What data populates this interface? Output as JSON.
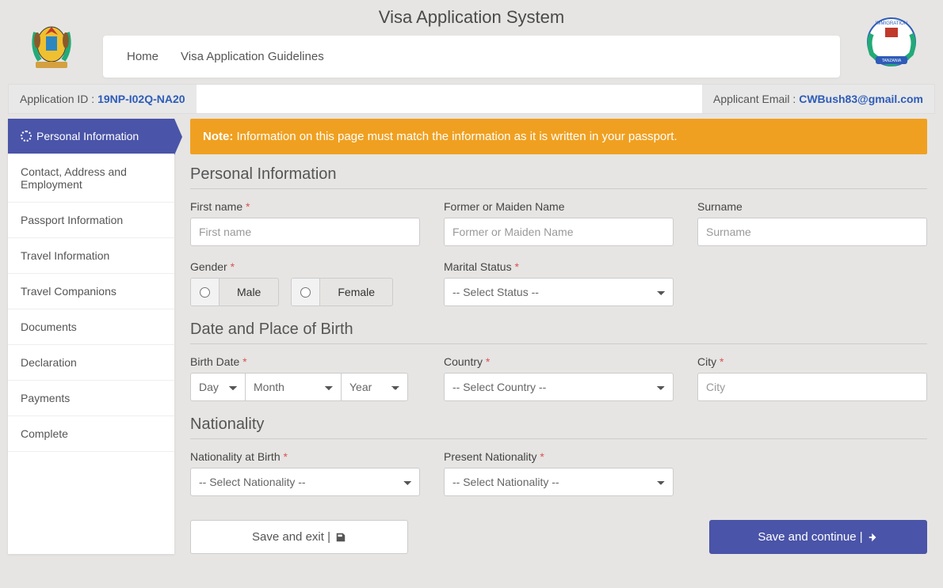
{
  "header": {
    "title": "Visa Application System",
    "nav": {
      "home": "Home",
      "guidelines": "Visa Application Guidelines"
    }
  },
  "idbar": {
    "left_label": "Application ID : ",
    "app_id": "19NP-I02Q-NA20",
    "right_label": "Applicant Email : ",
    "email": "CWBush83@gmail.com"
  },
  "sidebar": {
    "items": [
      "Personal Information",
      "Contact, Address and Employment",
      "Passport Information",
      "Travel Information",
      "Travel Companions",
      "Documents",
      "Declaration",
      "Payments",
      "Complete"
    ]
  },
  "alert": {
    "bold": "Note:",
    "text": " Information on this page must match the information as it is written in your passport."
  },
  "sections": {
    "personal": {
      "title": "Personal Information",
      "first_name": {
        "label": "First name ",
        "placeholder": "First name"
      },
      "former": {
        "label": "Former or Maiden Name",
        "placeholder": "Former or Maiden Name"
      },
      "surname": {
        "label": "Surname",
        "placeholder": "Surname"
      },
      "gender": {
        "label": "Gender ",
        "male": "Male",
        "female": "Female"
      },
      "marital": {
        "label": "Marital Status ",
        "placeholder": "-- Select Status --"
      }
    },
    "dob": {
      "title": "Date and Place of Birth",
      "birth_date": {
        "label": "Birth Date ",
        "day": "Day",
        "month": "Month",
        "year": "Year"
      },
      "country": {
        "label": "Country ",
        "placeholder": "-- Select Country --"
      },
      "city": {
        "label": "City ",
        "placeholder": "City"
      }
    },
    "nat": {
      "title": "Nationality",
      "birth": {
        "label": "Nationality at Birth ",
        "placeholder": "-- Select Nationality --"
      },
      "present": {
        "label": "Present Nationality ",
        "placeholder": "-- Select Nationality --"
      }
    }
  },
  "actions": {
    "save_exit": "Save and exit | ",
    "save_continue": "Save and continue | "
  }
}
